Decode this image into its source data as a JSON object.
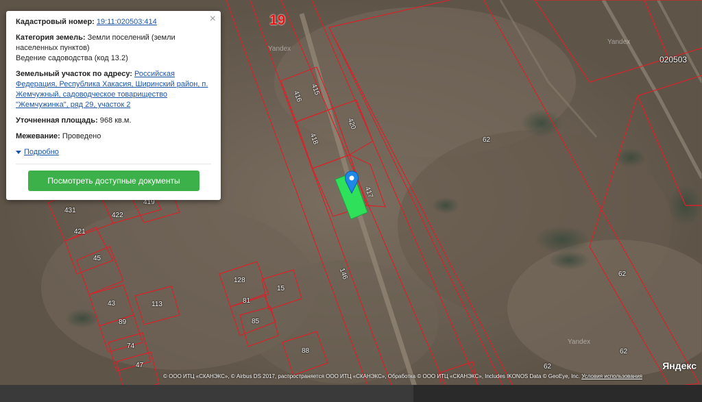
{
  "map": {
    "sheet_number": "19",
    "quarter_number": "020503",
    "watermark": "Yandex",
    "yandex_logo": "Яндекс",
    "plots": [
      {
        "id": "p416",
        "label": "416"
      },
      {
        "id": "p415",
        "label": "415"
      },
      {
        "id": "p418",
        "label": "418"
      },
      {
        "id": "p420",
        "label": "420"
      },
      {
        "id": "p417",
        "label": "417"
      },
      {
        "id": "p62a",
        "label": "62"
      },
      {
        "id": "p62b",
        "label": "62"
      },
      {
        "id": "p62c",
        "label": "62"
      },
      {
        "id": "p62d",
        "label": "62"
      },
      {
        "id": "p431",
        "label": "431"
      },
      {
        "id": "p419",
        "label": "419"
      },
      {
        "id": "p422",
        "label": "422"
      },
      {
        "id": "p421",
        "label": "421"
      },
      {
        "id": "p45",
        "label": "45"
      },
      {
        "id": "p128",
        "label": "128"
      },
      {
        "id": "p81",
        "label": "81"
      },
      {
        "id": "p15",
        "label": "15"
      },
      {
        "id": "p85",
        "label": "85"
      },
      {
        "id": "p43",
        "label": "43"
      },
      {
        "id": "p113",
        "label": "113"
      },
      {
        "id": "p89",
        "label": "89"
      },
      {
        "id": "p74",
        "label": "74"
      },
      {
        "id": "p47",
        "label": "47"
      },
      {
        "id": "p88",
        "label": "88"
      },
      {
        "id": "p146",
        "label": "146"
      }
    ],
    "selected_plot_color": "#2ee05a",
    "boundary_color": "#d8232a",
    "marker_color": "#1e88e5"
  },
  "popup": {
    "cadastral": {
      "key": "Кадастровый номер:",
      "value": "19:11:020503:414"
    },
    "category": {
      "key": "Категория земель:",
      "value": "Земли поселений (земли населенных пунктов)",
      "use": "Ведение садоводства (код 13.2)"
    },
    "address": {
      "key": "Земельный участок по адресу:",
      "value": "Российская Федерация, Республика Хакасия, Ширинский район, п. Жемчужный, садоводческое товарищество \"Жемчужинка\", ряд 29, участок 2"
    },
    "area": {
      "key": "Уточненная площадь:",
      "value": "968 кв.м."
    },
    "survey": {
      "key": "Межевание:",
      "value": "Проведено"
    },
    "details_link": "Подробно",
    "docs_button": "Посмотреть доступные документы",
    "close_icon": "close-icon"
  },
  "footer": {
    "copyright": "© ООО ИТЦ «СКАНЭКС», © Airbus DS 2017, распространяется ООО ИТЦ «СКАНЭКС», Обработка © ООО ИТЦ «СКАНЭКС», Includes IKONOS Data © GeoEye, Inc.",
    "terms": "Условия использования"
  }
}
